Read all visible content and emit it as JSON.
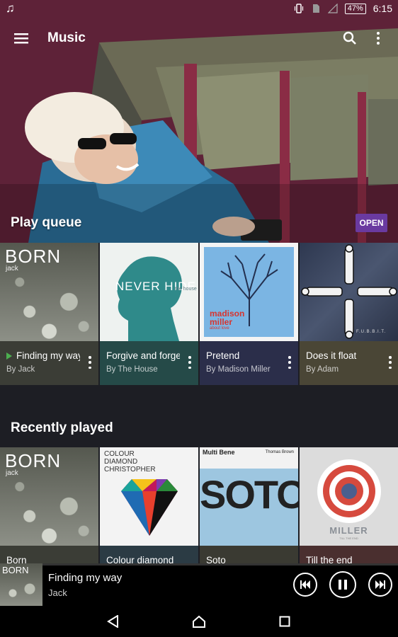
{
  "status_bar": {
    "music_icon": "music-note-icon",
    "battery": "47%",
    "time": "6:15"
  },
  "app_bar": {
    "title": "Music",
    "menu_icon": "menu-icon",
    "search_icon": "search-icon",
    "more_icon": "more-vert-icon"
  },
  "hero": {
    "label": "Play queue",
    "open_button": "OPEN"
  },
  "play_queue": [
    {
      "title": "Finding my way",
      "artist": "By Jack",
      "playing": true,
      "info_color": "#3b3d36"
    },
    {
      "title": "Forgive and forget",
      "artist": "By The House",
      "playing": false,
      "info_color": "#254a48"
    },
    {
      "title": "Pretend",
      "artist": "By Madison Miller",
      "playing": false,
      "info_color": "#2b2e4a"
    },
    {
      "title": "Does it float",
      "artist": "By Adam",
      "playing": false,
      "info_color": "#4a4636"
    }
  ],
  "play_queue_art": {
    "born": {
      "title": "BORN",
      "sub": "jack"
    },
    "never_hide": {
      "title": "NEVER HIDE",
      "sub": "the house"
    },
    "madison": {
      "title": "madison miller",
      "sub": "about love"
    },
    "adam": {
      "title": "F.U.B.B.I.T."
    }
  },
  "recently_played": {
    "title": "Recently played",
    "items": [
      {
        "title": "Born",
        "info_color": "#3b3d36"
      },
      {
        "title": "Colour diamond",
        "info_color": "#2b3b44"
      },
      {
        "title": "Soto",
        "info_color": "#3a3a32"
      },
      {
        "title": "Till the end",
        "info_color": "#4a2f2f"
      }
    ]
  },
  "recent_art": {
    "born": {
      "title": "BORN",
      "sub": "jack"
    },
    "colour_diamond": {
      "line1": "COLOUR",
      "line2": "DIAMOND",
      "line3": "CHRISTOPHER"
    },
    "soto": {
      "artist": "Multi Bene",
      "label": "Thomas Brown",
      "big": "SOTO"
    },
    "miller": {
      "title": "MILLER",
      "sub": "TILL THE END"
    }
  },
  "now_playing": {
    "title": "Finding my way",
    "artist": "Jack",
    "progress": 0.1,
    "accent_color": "#6a3aa0"
  },
  "nav_bar": {
    "back_icon": "back-icon",
    "home_icon": "home-icon",
    "recents_icon": "recents-icon"
  }
}
